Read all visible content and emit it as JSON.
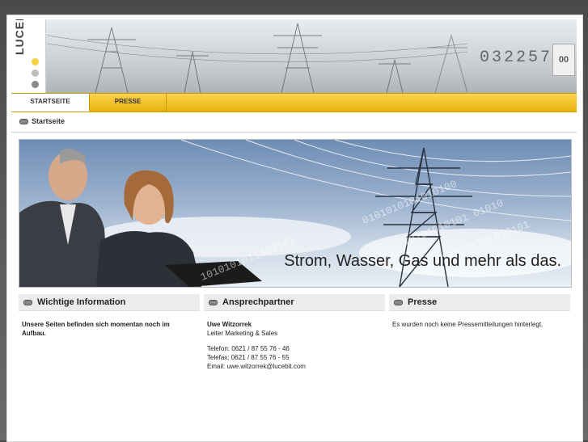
{
  "header": {
    "logo": "LUCEBIT",
    "counter": "032257",
    "counter_box": "00"
  },
  "nav": {
    "items": [
      {
        "label": "STARTSEITE"
      },
      {
        "label": "PRESSE"
      }
    ]
  },
  "breadcrumb": {
    "label": "Startseite"
  },
  "banner": {
    "caption": "Strom, Wasser, Gas und mehr als das."
  },
  "columns": {
    "info": {
      "title": "Wichtige Information",
      "text": "Unsere Seiten befinden sich momentan noch im Aufbau."
    },
    "contact": {
      "title": "Ansprechpartner",
      "name": "Uwe Witzorrek",
      "role": "Leiter Marketing & Sales",
      "phone": "Telefon: 0621 / 87 55 76 - 46",
      "fax": "Telefax: 0621 / 87 55 76 - 55",
      "email": "Email: uwe.witzorrek@lucebit.com"
    },
    "press": {
      "title": "Presse",
      "text": "Es wurden noch keine Pressemitteilungen hinterlegt."
    }
  },
  "colors": {
    "nav_yellow": "#f5c518",
    "logo_dot_yellow": "#f6d33c"
  }
}
